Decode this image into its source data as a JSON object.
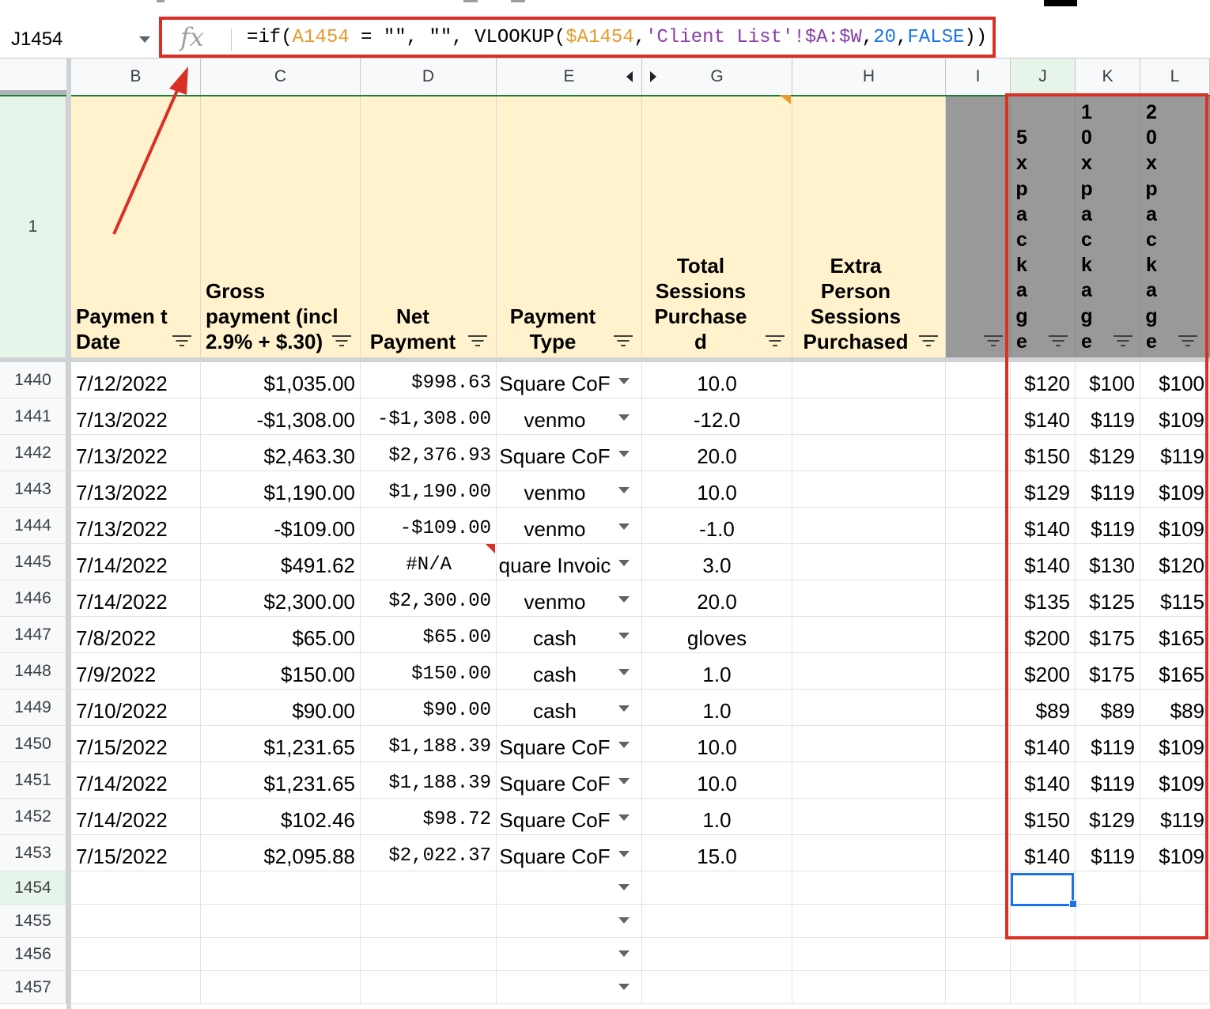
{
  "namebox": {
    "cell": "J1454"
  },
  "formula_bar": {
    "fx": "fx",
    "parts": [
      "=if(",
      "A1454",
      " = \"\", \"\", VLOOKUP(",
      "$A1454",
      ",",
      "'Client List'!$A:$W",
      ",",
      "20",
      ",",
      "FALSE",
      "))"
    ]
  },
  "columns": [
    "B",
    "C",
    "D",
    "E",
    "G",
    "H",
    "I",
    "J",
    "K",
    "L"
  ],
  "header_row": {
    "row_number": "1",
    "B": "Paymen t Date",
    "C": "Gross payment (incl 2.9% + $.30)",
    "D": "Net Payment",
    "E": "Payment Type",
    "G": "Total Sessions Purchase d",
    "H": "Extra Person Sessions Purchased",
    "I": "",
    "J": "5xpackage",
    "K": "10xpackage",
    "L": "20xpackage"
  },
  "rows": [
    {
      "n": "1440",
      "date": "7/12/2022",
      "gross": "$1,035.00",
      "net": "$998.63",
      "type": "Square CoF",
      "sessions": "10.0",
      "j": "$120",
      "k": "$100",
      "l": "$100"
    },
    {
      "n": "1441",
      "date": "7/13/2022",
      "gross": "-$1,308.00",
      "net": "-$1,308.00",
      "type": "venmo",
      "sessions": "-12.0",
      "j": "$140",
      "k": "$119",
      "l": "$109"
    },
    {
      "n": "1442",
      "date": "7/13/2022",
      "gross": "$2,463.30",
      "net": "$2,376.93",
      "type": "Square CoF",
      "sessions": "20.0",
      "j": "$150",
      "k": "$129",
      "l": "$119"
    },
    {
      "n": "1443",
      "date": "7/13/2022",
      "gross": "$1,190.00",
      "net": "$1,190.00",
      "type": "venmo",
      "sessions": "10.0",
      "j": "$129",
      "k": "$119",
      "l": "$109"
    },
    {
      "n": "1444",
      "date": "7/13/2022",
      "gross": "-$109.00",
      "net": "-$109.00",
      "type": "venmo",
      "sessions": "-1.0",
      "j": "$140",
      "k": "$119",
      "l": "$109"
    },
    {
      "n": "1445",
      "date": "7/14/2022",
      "gross": "$491.62",
      "net": "#N/A",
      "type": "quare Invoic",
      "sessions": "3.0",
      "j": "$140",
      "k": "$130",
      "l": "$120"
    },
    {
      "n": "1446",
      "date": "7/14/2022",
      "gross": "$2,300.00",
      "net": "$2,300.00",
      "type": "venmo",
      "sessions": "20.0",
      "j": "$135",
      "k": "$125",
      "l": "$115"
    },
    {
      "n": "1447",
      "date": "7/8/2022",
      "gross": "$65.00",
      "net": "$65.00",
      "type": "cash",
      "sessions": "gloves",
      "j": "$200",
      "k": "$175",
      "l": "$165"
    },
    {
      "n": "1448",
      "date": "7/9/2022",
      "gross": "$150.00",
      "net": "$150.00",
      "type": "cash",
      "sessions": "1.0",
      "j": "$200",
      "k": "$175",
      "l": "$165"
    },
    {
      "n": "1449",
      "date": "7/10/2022",
      "gross": "$90.00",
      "net": "$90.00",
      "type": "cash",
      "sessions": "1.0",
      "j": "$89",
      "k": "$89",
      "l": "$89"
    },
    {
      "n": "1450",
      "date": "7/15/2022",
      "gross": "$1,231.65",
      "net": "$1,188.39",
      "type": "Square CoF",
      "sessions": "10.0",
      "j": "$140",
      "k": "$119",
      "l": "$109"
    },
    {
      "n": "1451",
      "date": "7/14/2022",
      "gross": "$1,231.65",
      "net": "$1,188.39",
      "type": "Square CoF",
      "sessions": "10.0",
      "j": "$140",
      "k": "$119",
      "l": "$109"
    },
    {
      "n": "1452",
      "date": "7/14/2022",
      "gross": "$102.46",
      "net": "$98.72",
      "type": "Square CoF",
      "sessions": "1.0",
      "j": "$150",
      "k": "$129",
      "l": "$119"
    },
    {
      "n": "1453",
      "date": "7/15/2022",
      "gross": "$2,095.88",
      "net": "$2,022.37",
      "type": "Square CoF",
      "sessions": "15.0",
      "j": "$140",
      "k": "$119",
      "l": "$109"
    },
    {
      "n": "1454",
      "date": "",
      "gross": "",
      "net": "",
      "type": "",
      "sessions": "",
      "j": "",
      "k": "",
      "l": ""
    },
    {
      "n": "1455",
      "date": "",
      "gross": "",
      "net": "",
      "type": "",
      "sessions": "",
      "j": "",
      "k": "",
      "l": ""
    },
    {
      "n": "1456",
      "date": "",
      "gross": "",
      "net": "",
      "type": "",
      "sessions": "",
      "j": "",
      "k": "",
      "l": ""
    },
    {
      "n": "1457",
      "date": "",
      "gross": "",
      "net": "",
      "type": "",
      "sessions": "",
      "j": "",
      "k": "",
      "l": ""
    }
  ],
  "colors": {
    "annotation": "#d93025",
    "header_fill": "#fff2cc",
    "gray_fill": "#999999",
    "selection": "#1a73e8"
  }
}
